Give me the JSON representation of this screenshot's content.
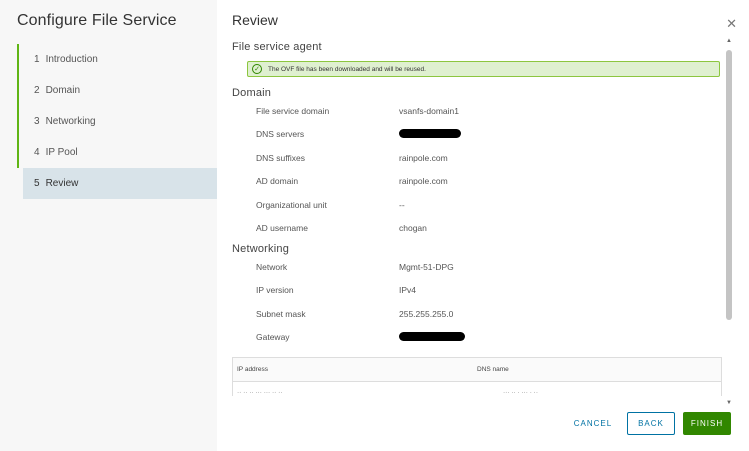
{
  "wizard": {
    "title": "Configure File Service",
    "steps": [
      {
        "num": "1",
        "label": "Introduction"
      },
      {
        "num": "2",
        "label": "Domain"
      },
      {
        "num": "3",
        "label": "Networking"
      },
      {
        "num": "4",
        "label": "IP Pool"
      },
      {
        "num": "5",
        "label": "Review"
      }
    ]
  },
  "review": {
    "title": "Review",
    "agent_section": "File service agent",
    "alert_text": "The OVF file has been downloaded and will be reused.",
    "domain_section": "Domain",
    "domain_rows": [
      {
        "label": "File service domain",
        "value": "vsanfs-domain1"
      },
      {
        "label": "DNS servers",
        "value": ""
      },
      {
        "label": "DNS suffixes",
        "value": "rainpole.com"
      },
      {
        "label": "AD domain",
        "value": "rainpole.com"
      },
      {
        "label": "Organizational unit",
        "value": "--"
      },
      {
        "label": "AD username",
        "value": "chogan"
      }
    ],
    "networking_section": "Networking",
    "networking_rows": [
      {
        "label": "Network",
        "value": "Mgmt-51-DPG"
      },
      {
        "label": "IP version",
        "value": "IPv4"
      },
      {
        "label": "Subnet mask",
        "value": "255.255.255.0"
      },
      {
        "label": "Gateway",
        "value": ""
      }
    ],
    "table": {
      "columns": [
        "IP address",
        "DNS name"
      ]
    }
  },
  "footer": {
    "cancel": "CANCEL",
    "back": "BACK",
    "finish": "FINISH"
  },
  "icons": {
    "close": "close-icon",
    "success": "check-circle-icon"
  },
  "colors": {
    "accent": "#0072a3",
    "finish": "#318700",
    "step_bar": "#60b515",
    "alert_bg": "#dff0d0"
  }
}
